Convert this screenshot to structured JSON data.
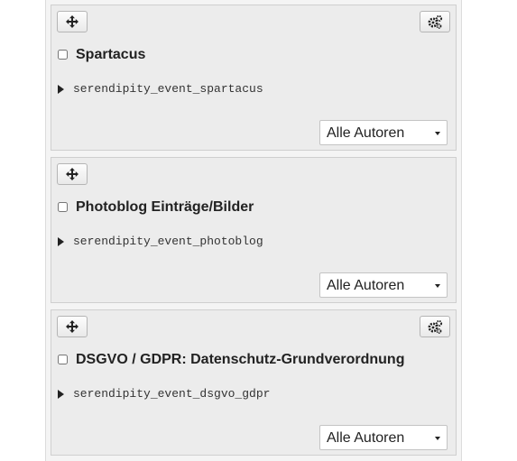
{
  "plugins": [
    {
      "title": "Spartacus",
      "event_name": "serendipity_event_spartacus",
      "author_filter": "Alle Autoren",
      "move_icon": "move-arrows-icon",
      "config_icon": "gears-icon"
    },
    {
      "title": "Photoblog Einträge/Bilder",
      "event_name": "serendipity_event_photoblog",
      "author_filter": "Alle Autoren",
      "move_icon": "move-arrows-icon"
    },
    {
      "title": "DSGVO / GDPR: Datenschutz-Grundverordnung",
      "event_name": "serendipity_event_dsgvo_gdpr",
      "author_filter": "Alle Autoren",
      "move_icon": "move-arrows-icon",
      "config_icon": "gears-icon"
    }
  ]
}
